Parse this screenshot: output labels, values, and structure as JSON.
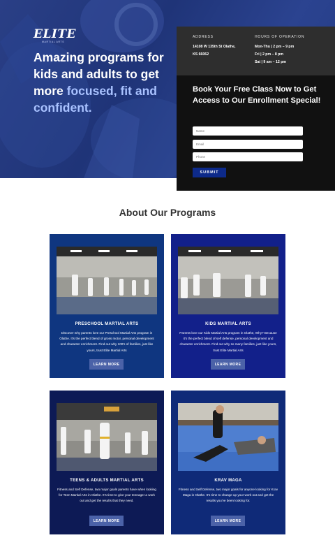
{
  "hero": {
    "logo_text": "ELITE",
    "logo_sub": "Martial Arts",
    "headline_part1": "Amazing programs for kids and adults to get more ",
    "headline_accent": "focused, fit and confident."
  },
  "info": {
    "address_heading": "Address",
    "address_line1": "14108 W 135th St Olathe,",
    "address_line2": "KS 66062",
    "hours_heading": "Hours of Operation",
    "hours": [
      "Mon-Thu | 2 pm – 9 pm",
      "Fri | 2 pm – 8 pm",
      "Sat | 9 am – 12 pm"
    ]
  },
  "form": {
    "title": "Book Your Free Class Now to Get Access to Our Enrollment Special!",
    "name_placeholder": "Name",
    "email_placeholder": "Email",
    "phone_placeholder": "Phone",
    "submit_label": "SUBMIT"
  },
  "about": {
    "title": "About Our Programs",
    "cards": [
      {
        "title": "Preschool Martial Arts",
        "description": "Discover why parents love our Preschool Martial Arts program in Olathe. It's the perfect blend of gross motor, personal development and character enrichment. Find out why 100's of families, just like yours, trust Elite Martial Arts",
        "button": "LEARN MORE"
      },
      {
        "title": "Kids Martial Arts",
        "description": "Parents love our Kids Martial Arts program in Olathe, Why? Because it's the perfect blend of self defense, personal development and character enrichment. Find out why so many families, just like yours, trust Elite Martial Arts",
        "button": "LEARN MORE"
      },
      {
        "title": "Teens & Adults Martial Arts",
        "description": "Fitness and Self Defense, two major goals parents have when looking for Teen Martial Arts in Olathe. It's time to give your teenager a work out and get the results that they need.",
        "button": "LEARN MORE"
      },
      {
        "title": "Krav Maga",
        "description": "Fitness and Self Defense, two major goals for anyone looking for Krav Maga in Olathe. It's time to change up your work out and get the results you've been looking for.",
        "button": "LEARN MORE"
      }
    ]
  },
  "colors": {
    "hero_bg": "#223a82",
    "accent_text": "#a9c2ff",
    "panel_bg": "#111111",
    "info_bg": "#2e2e2e",
    "submit_bg": "#0d2a8a",
    "card_btn": "#4b62a8"
  }
}
